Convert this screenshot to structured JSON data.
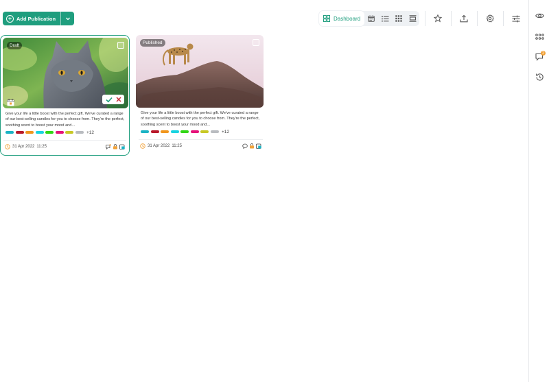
{
  "toolbar": {
    "add_label": "Add Publication",
    "view_dashboard_label": "Dashboard",
    "accent_color": "#1f9e7e"
  },
  "views": [
    {
      "name": "dashboard",
      "icon": "grid-icon",
      "active": true
    },
    {
      "name": "calendar",
      "icon": "calendar-icon",
      "active": false
    },
    {
      "name": "list",
      "icon": "list-icon",
      "active": false
    },
    {
      "name": "grid",
      "icon": "dots-grid-icon",
      "active": false
    },
    {
      "name": "feed",
      "icon": "feed-icon",
      "active": false
    }
  ],
  "tools": [
    "star-icon",
    "upload-icon",
    "gear-icon",
    "sliders-icon"
  ],
  "rail": {
    "items": [
      "eye-icon",
      "apps-icon",
      "chat-icon",
      "history-icon"
    ],
    "chat_badge": "2"
  },
  "cards": [
    {
      "status": "Draft",
      "image": "gray-cat-photo",
      "text": "Give your life a little boost with the perfect gift. We've curated a range of our best-selling candles for you to choose from. They're the perfect, soothing scent to boost your mood and...",
      "tags_more": "+12",
      "date": "31 Apr 2022",
      "time": "11:25",
      "selected": true
    },
    {
      "status": "Published",
      "image": "leopard-on-rock-photo",
      "text": "Give your life a little boost with the perfect gift. We've curated a range of our best-selling candles for you to choose from. They're the perfect, soothing scent to boost your mood and...",
      "tags_more": "+12",
      "date": "31 Apr 2022",
      "time": "11:25",
      "selected": false
    }
  ],
  "tag_colors": [
    "#1bb3c4",
    "#b8182a",
    "#f0961e",
    "#19d3e0",
    "#32d616",
    "#e5127a",
    "#c8c825",
    "#b9bcc0"
  ]
}
